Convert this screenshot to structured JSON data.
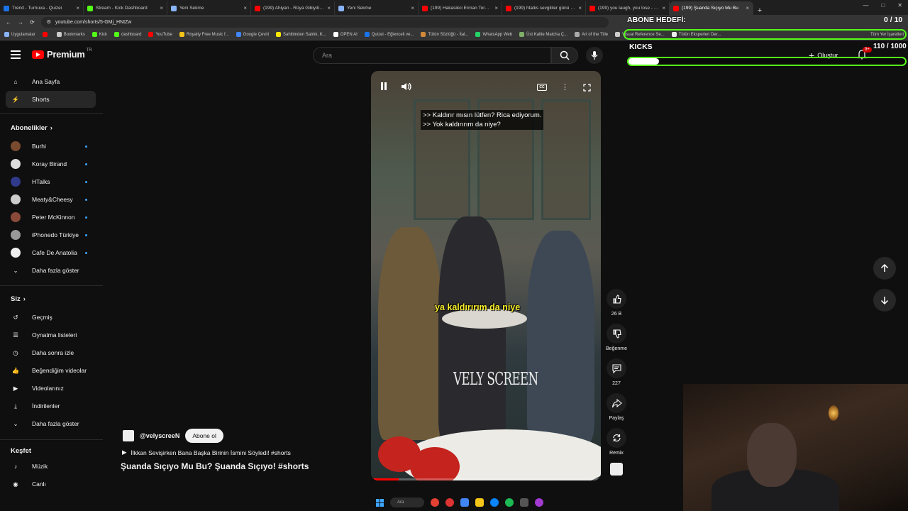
{
  "browser": {
    "tabs": [
      {
        "title": "Trend - Turnuva - Quizei",
        "color": "#1a73e8",
        "active": false
      },
      {
        "title": "Stream - Kick Dashboard",
        "color": "#53fc18",
        "active": false
      },
      {
        "title": "Yeni Sekme",
        "color": "#8ab4f8",
        "active": false
      },
      {
        "title": "(199) Ahiyan - Rüya Gibiydin (l",
        "color": "#ff0000",
        "active": false
      },
      {
        "title": "Yeni Sekme",
        "color": "#8ab4f8",
        "active": false
      },
      {
        "title": "(199) Hakasikci Erman Toroğlu",
        "color": "#ff0000",
        "active": false
      },
      {
        "title": "(199) htalks sevgililer günü özel",
        "color": "#ff0000",
        "active": false
      },
      {
        "title": "(199) you laugh, you lose - You",
        "color": "#ff0000",
        "active": false
      },
      {
        "title": "(199) Şuanda Sıçıyo Mu Bu",
        "color": "#ff0000",
        "active": true
      }
    ],
    "url": "youtube.com/shorts/5-GMj_HNtZw",
    "bookmarks": [
      {
        "label": "Uygulamalar",
        "color": "#8ab4f8"
      },
      {
        "label": "",
        "color": "#ff0000"
      },
      {
        "label": "Bookmarks",
        "color": "#ccc"
      },
      {
        "label": "Kick",
        "color": "#53fc18"
      },
      {
        "label": "dashboard",
        "color": "#53fc18"
      },
      {
        "label": "YouTube",
        "color": "#ff0000"
      },
      {
        "label": "Royalty Free Music f...",
        "color": "#f5c518"
      },
      {
        "label": "Google Çeviri",
        "color": "#4285f4"
      },
      {
        "label": "Sahibinden Satılık, K...",
        "color": "#ffe800"
      },
      {
        "label": "OPEN AI",
        "color": "#ffffff"
      },
      {
        "label": "Quizei - Eğlenceli ve...",
        "color": "#1a73e8"
      },
      {
        "label": "Tütün Sözlüğü - İtal...",
        "color": "#d08a3a"
      },
      {
        "label": "WhatsApp Web",
        "color": "#25d366"
      },
      {
        "label": "Üst Kalite Matcha Ç...",
        "color": "#7fb069"
      },
      {
        "label": "Art of the Title",
        "color": "#aaaaaa"
      },
      {
        "label": "Visual Reference Se...",
        "color": "#cccccc"
      },
      {
        "label": "Tütün Eksperleri Der...",
        "color": "#eeeeee"
      }
    ],
    "all_bookmarks": "Tüm Yer İşaretleri"
  },
  "youtube": {
    "logo": "Premium",
    "logo_suffix": "TR",
    "search_placeholder": "Ara",
    "create_label": "Oluştur",
    "notif_badge": "9+",
    "sidebar": {
      "main": [
        {
          "label": "Ana Sayfa",
          "icon": "home-icon"
        },
        {
          "label": "Shorts",
          "icon": "shorts-icon",
          "active": true
        }
      ],
      "subscriptions_title": "Abonelikler",
      "subscriptions": [
        {
          "label": "Burhi",
          "color": "#7a4a2f"
        },
        {
          "label": "Koray Birand",
          "color": "#dddddd"
        },
        {
          "label": "HTalks",
          "color": "#2f3a8a"
        },
        {
          "label": "Meaty&Cheesy",
          "color": "#cccccc"
        },
        {
          "label": "Peter McKinnon",
          "color": "#8a4a3a"
        },
        {
          "label": "iPhonedo Türkiye",
          "color": "#999999"
        },
        {
          "label": "Cafe De Anatolia",
          "color": "#eeeeee"
        }
      ],
      "more_subs": "Daha fazla göster",
      "you_title": "Siz",
      "you_items": [
        {
          "label": "Geçmiş",
          "icon": "history-icon"
        },
        {
          "label": "Oynatma listeleri",
          "icon": "playlists-icon"
        },
        {
          "label": "Daha sonra izle",
          "icon": "watch-later-icon"
        },
        {
          "label": "Beğendiğim videolar",
          "icon": "liked-icon"
        },
        {
          "label": "Videolarınız",
          "icon": "your-videos-icon"
        },
        {
          "label": "İndirilenler",
          "icon": "downloads-icon"
        }
      ],
      "more_you": "Daha fazla göster",
      "explore_title": "Keşfet",
      "explore_items": [
        {
          "label": "Müzik",
          "icon": "music-icon"
        },
        {
          "label": "Canlı",
          "icon": "live-icon"
        }
      ]
    },
    "short": {
      "subtitle_line1": ">> Kaldırır mısın lütfen? Rica ediyorum.",
      "subtitle_line2": ">> Yok kaldırırım da niye?",
      "burned_caption": "ya kaldırırım da niye",
      "watermark": "VELY SCREEN",
      "channel": "@velyscreeN",
      "subscribe": "Abone ol",
      "song": "İlkkan Sevişirken Bana Başka Birinin İsmini Söyledi! #shorts",
      "title": "Şuanda Sıçıyo Mu Bu? Şuanda Sıçıyo! #shorts",
      "progress": 0.12,
      "actions": [
        {
          "label": "26 B",
          "icon": "like-icon"
        },
        {
          "label": "Beğenme",
          "icon": "dislike-icon"
        },
        {
          "label": "227",
          "icon": "comment-icon"
        },
        {
          "label": "Paylaş",
          "icon": "share-icon"
        },
        {
          "label": "Remix",
          "icon": "remix-icon"
        }
      ]
    }
  },
  "overlay": {
    "abone_title": "ABONE HEDEFİ:",
    "abone_count": "0 / 10",
    "kicks_title": "KICKS",
    "kicks_count": "110 / 1000",
    "kicks_progress": 0.11,
    "accent": "#53fc18"
  },
  "taskbar": {
    "search": "Ara"
  }
}
